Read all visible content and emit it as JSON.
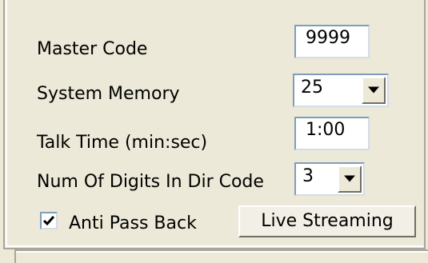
{
  "settings": {
    "master_code": {
      "label": "Master Code",
      "value": "9999"
    },
    "system_memory": {
      "label": "System Memory",
      "value": "25"
    },
    "talk_time": {
      "label": "Talk Time (min:sec)",
      "value": "1:00"
    },
    "num_digits": {
      "label": "Num Of Digits In Dir Code",
      "value": "3"
    },
    "anti_pass_back": {
      "label": "Anti Pass Back",
      "checked": true
    },
    "live_streaming_button": {
      "label": "Live Streaming"
    }
  },
  "icons": {
    "dropdown": "chevron-down-icon",
    "check": "checkmark-icon"
  },
  "colors": {
    "background": "#ece9d8",
    "field_border": "#7f9db9"
  }
}
